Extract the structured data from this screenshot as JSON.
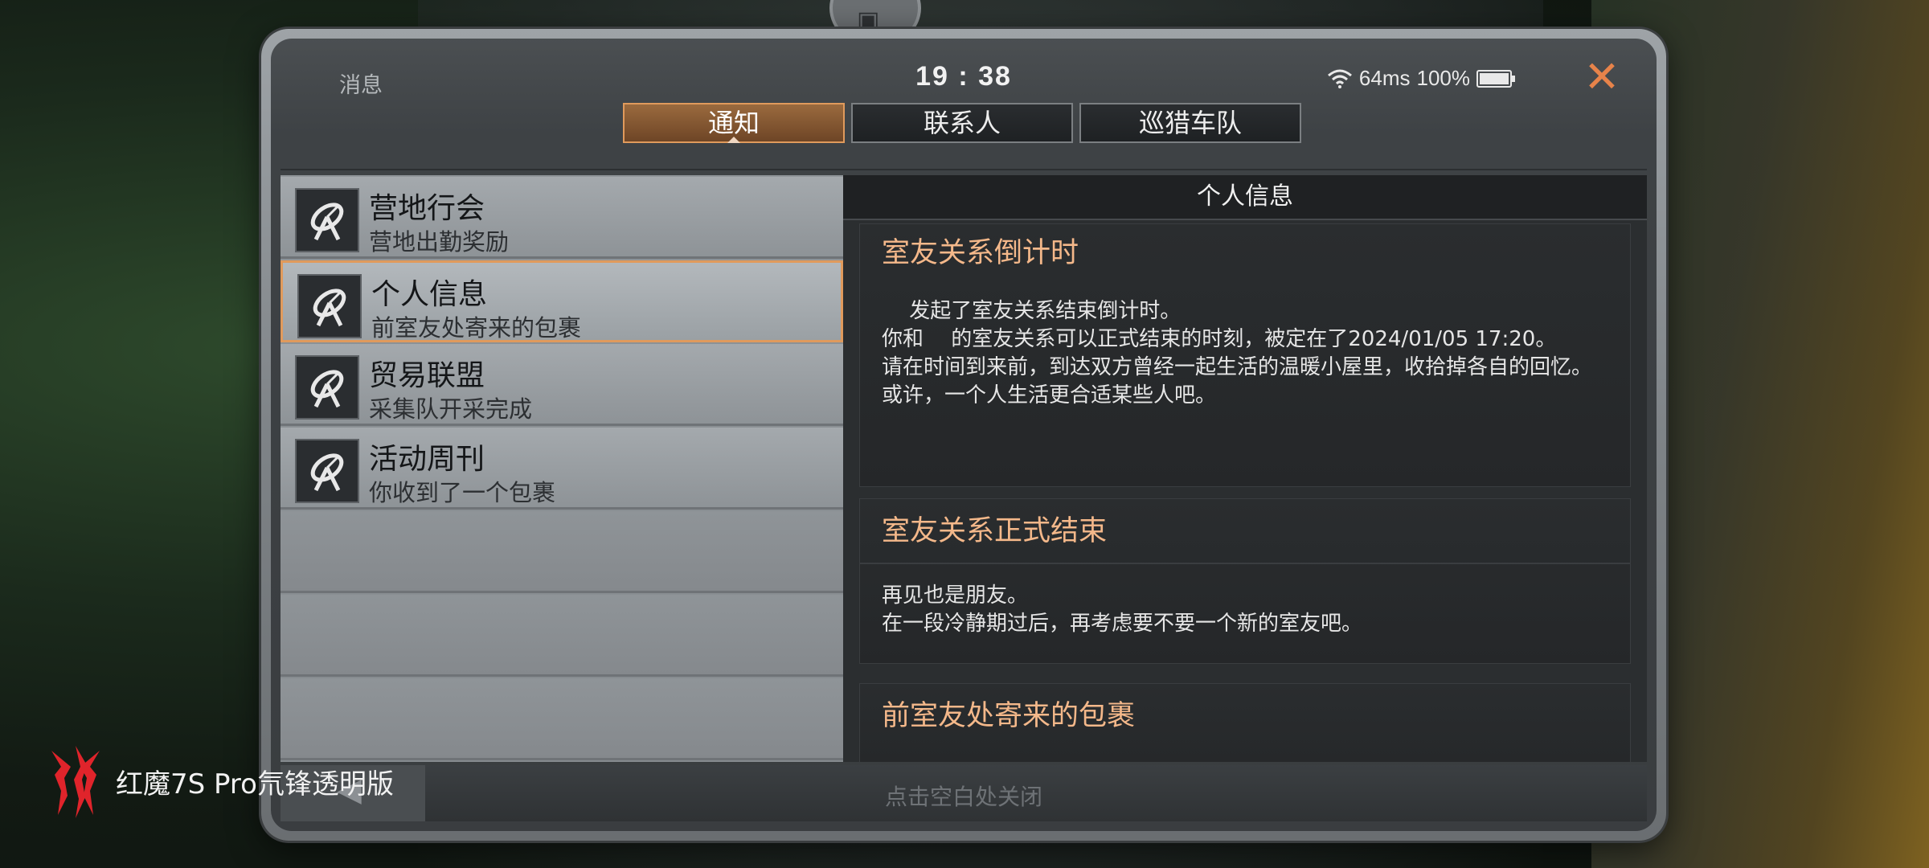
{
  "status": {
    "app_title": "消息",
    "time": "19 : 38",
    "latency": "64ms",
    "battery": "100%"
  },
  "tabs": [
    {
      "label": "通知",
      "active": true
    },
    {
      "label": "联系人",
      "active": false
    },
    {
      "label": "巡猎车队",
      "active": false
    }
  ],
  "messages": [
    {
      "title": "营地行会",
      "subtitle": "营地出勤奖励",
      "icon": "satellite-dish-icon",
      "selected": false
    },
    {
      "title": "个人信息",
      "subtitle": "前室友处寄来的包裹",
      "icon": "satellite-dish-icon",
      "selected": true
    },
    {
      "title": "贸易联盟",
      "subtitle": "采集队开采完成",
      "icon": "satellite-dish-icon",
      "selected": false
    },
    {
      "title": "活动周刊",
      "subtitle": "你收到了一个包裹",
      "icon": "satellite-dish-icon",
      "selected": false
    }
  ],
  "detail": {
    "header": "个人信息",
    "cards": [
      {
        "title": "室友关系倒计时",
        "lines": [
          "　 发起了室友关系结束倒计时。",
          "你和　 的室友关系可以正式结束的时刻，被定在了2024/01/05 17:20。",
          "请在时间到来前，到达双方曾经一起生活的温暖小屋里，收拾掉各自的回忆。",
          "或许，一个人生活更合适某些人吧。"
        ]
      },
      {
        "title": "室友关系正式结束",
        "lines": [
          "再见也是朋友。",
          "在一段冷静期过后，再考虑要不要一个新的室友吧。"
        ]
      },
      {
        "title": "前室友处寄来的包裹",
        "lines": []
      }
    ]
  },
  "bottom_hint": "点击空白处关闭",
  "watermark": "红魔7S Pro氘锋透明版",
  "colors": {
    "accent": "#e09a5c",
    "card_title": "#f4b88a",
    "close": "#e7834a"
  }
}
